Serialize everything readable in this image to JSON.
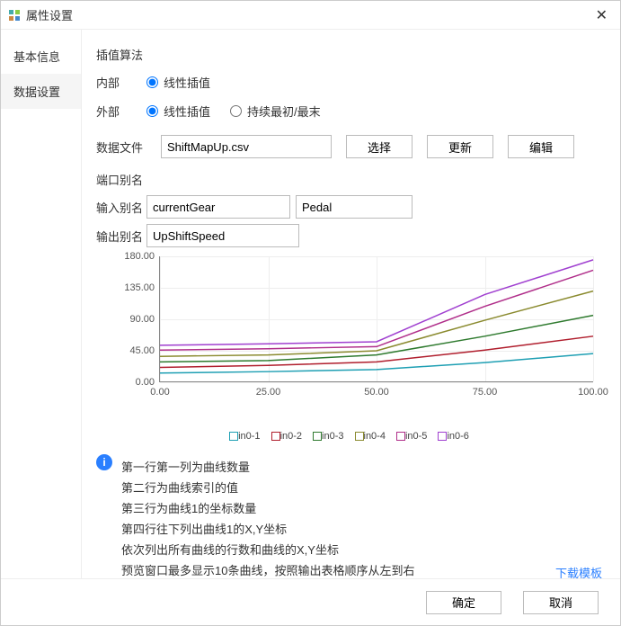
{
  "window": {
    "title": "属性设置"
  },
  "sidebar": {
    "tabs": [
      {
        "label": "基本信息"
      },
      {
        "label": "数据设置"
      }
    ]
  },
  "interp": {
    "section": "插值算法",
    "inner_label": "内部",
    "outer_label": "外部",
    "linear": "线性插值",
    "keep": "持续最初/最末"
  },
  "file": {
    "label": "数据文件",
    "value": "ShiftMapUp.csv",
    "select": "选择",
    "refresh": "更新",
    "edit": "编辑"
  },
  "alias": {
    "section": "端口别名",
    "in_label": "输入别名",
    "in1": "currentGear",
    "in2": "Pedal",
    "out_label": "输出别名",
    "out": "UpShiftSpeed"
  },
  "chart_data": {
    "type": "line",
    "xlabel": "",
    "ylabel": "",
    "xlim": [
      0,
      100
    ],
    "ylim": [
      0,
      180
    ],
    "xticks": [
      0,
      25,
      50,
      75,
      100
    ],
    "yticks": [
      0,
      45,
      90,
      135,
      180
    ],
    "xtick_labels": [
      "0.00",
      "25.00",
      "50.00",
      "75.00",
      "100.00"
    ],
    "ytick_labels": [
      "0.00",
      "45.00",
      "90.00",
      "135.00",
      "180.00"
    ],
    "x": [
      0,
      25,
      50,
      75,
      100
    ],
    "series": [
      {
        "name": "in0-1",
        "color": "#1e9fb3",
        "values": [
          12,
          14,
          17,
          27,
          40
        ]
      },
      {
        "name": "in0-2",
        "color": "#b01e2d",
        "values": [
          20,
          23,
          28,
          45,
          65
        ]
      },
      {
        "name": "in0-3",
        "color": "#2e7a2e",
        "values": [
          28,
          30,
          38,
          65,
          95
        ]
      },
      {
        "name": "in0-4",
        "color": "#8a8a2e",
        "values": [
          36,
          38,
          44,
          88,
          130
        ]
      },
      {
        "name": "in0-5",
        "color": "#b02e8a",
        "values": [
          45,
          47,
          50,
          108,
          160
        ]
      },
      {
        "name": "in0-6",
        "color": "#a040d0",
        "values": [
          52,
          54,
          57,
          125,
          175
        ]
      }
    ]
  },
  "info": {
    "l1": "第一行第一列为曲线数量",
    "l2": "第二行为曲线索引的值",
    "l3": "第三行为曲线1的坐标数量",
    "l4": "第四行往下列出曲线1的X,Y坐标",
    "l5": "依次列出所有曲线的行数和曲线的X,Y坐标",
    "l6": "预览窗口最多显示10条曲线，按照输出表格顺序从左到右"
  },
  "download": "下载模板",
  "footer": {
    "ok": "确定",
    "cancel": "取消"
  }
}
